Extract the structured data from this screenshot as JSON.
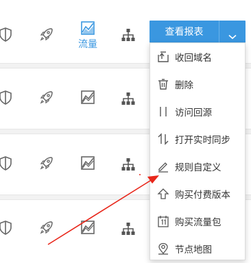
{
  "row1": {
    "flow_label": "流量"
  },
  "report_button": {
    "label": "查看报表"
  },
  "dropdown_menu": {
    "items": [
      {
        "label": "收回域名",
        "icon": "reclaim-icon"
      },
      {
        "label": "删除",
        "icon": "trash-icon"
      },
      {
        "label": "访问回源",
        "icon": "origin-icon"
      },
      {
        "label": "打开实时同步",
        "icon": "sync-icon"
      },
      {
        "label": "规则自定义",
        "icon": "pencil-icon"
      },
      {
        "label": "购买付费版本",
        "icon": "upgrade-arrow-icon"
      },
      {
        "label": "购买流量包",
        "icon": "package-icon"
      },
      {
        "label": "节点地图",
        "icon": "map-pin-icon"
      }
    ]
  },
  "colors": {
    "accent": "#3a97e0",
    "icon_gray": "#666666",
    "annotation_arrow": "#e8271b"
  }
}
